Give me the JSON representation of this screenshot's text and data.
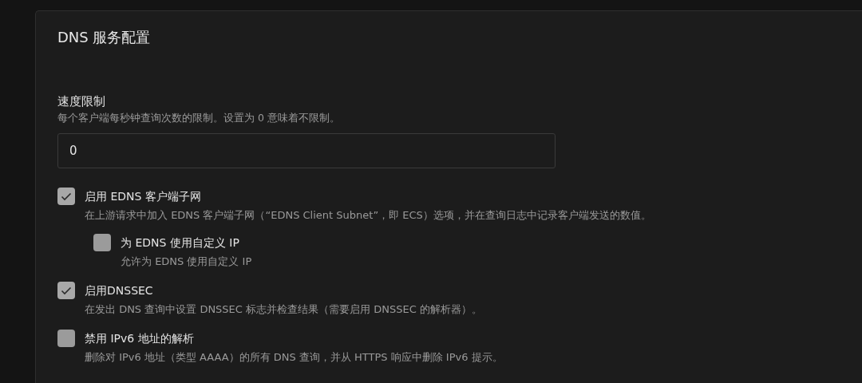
{
  "card": {
    "title": "DNS 服务配置"
  },
  "rate_limit": {
    "label": "速度限制",
    "hint": "每个客户端每秒钟查询次数的限制。设置为 0 意味着不限制。",
    "value": "0"
  },
  "options": [
    {
      "label": "启用 EDNS 客户端子网",
      "hint": "在上游请求中加入 EDNS 客户端子网（“EDNS Client Subnet”，即 ECS）选项，并在查询日志中记录客户端发送的数值。",
      "checked": true,
      "children": [
        {
          "label": "为 EDNS 使用自定义 IP",
          "hint": "允许为 EDNS 使用自定义 IP",
          "checked": false
        }
      ]
    },
    {
      "label": "启用DNSSEC",
      "hint": "在发出 DNS 查询中设置 DNSSEC 标志并检查结果（需要启用 DNSSEC 的解析器）。",
      "checked": true
    },
    {
      "label": "禁用 IPv6 地址的解析",
      "hint": "删除对 IPv6 地址（类型 AAAA）的所有 DNS 查询，并从 HTTPS 响应中删除 IPv6 提示。",
      "checked": false
    }
  ]
}
